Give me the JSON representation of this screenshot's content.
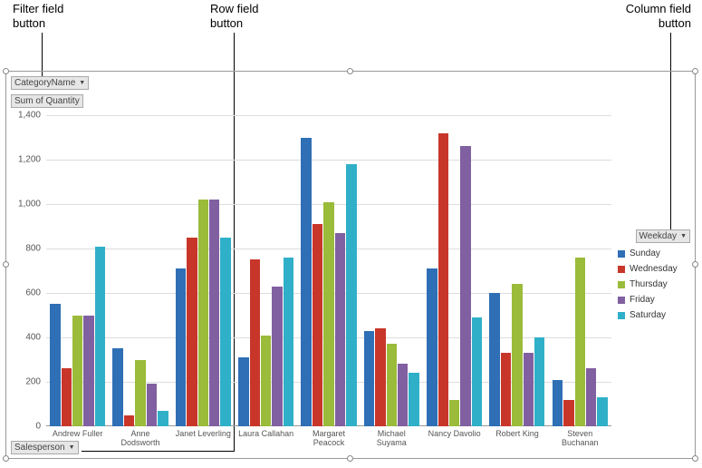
{
  "callouts": {
    "filter": {
      "line1": "Filter field",
      "line2": "button"
    },
    "row": {
      "line1": "Row field",
      "line2": "button"
    },
    "column": {
      "line1": "Column field",
      "line2": "button"
    }
  },
  "buttons": {
    "category": "CategoryName",
    "sum": "Sum of Quantity",
    "salesperson": "Salesperson",
    "weekday": "Weekday"
  },
  "legend": {
    "items": [
      {
        "label": "Sunday",
        "color": "#2F6FB5"
      },
      {
        "label": "Wednesday",
        "color": "#C8362A"
      },
      {
        "label": "Thursday",
        "color": "#9BBB3A"
      },
      {
        "label": "Friday",
        "color": "#8060A0"
      },
      {
        "label": "Saturday",
        "color": "#2FB0C8"
      }
    ]
  },
  "y_axis": {
    "ticks": [
      "0",
      "200",
      "400",
      "600",
      "800",
      "1,000",
      "1,200",
      "1,400"
    ],
    "max": 1400
  },
  "chart_data": {
    "type": "bar",
    "title": "Sum of Quantity",
    "xlabel": "Salesperson",
    "ylabel": "Sum of Quantity",
    "ylim": [
      0,
      1400
    ],
    "categories": [
      "Andrew Fuller",
      "Anne Dodsworth",
      "Janet Leverling",
      "Laura Callahan",
      "Margaret Peacock",
      "Michael Suyama",
      "Nancy Davolio",
      "Robert King",
      "Steven Buchanan"
    ],
    "category_labels": [
      "Andrew Fuller",
      "Anne\nDodsworth",
      "Janet Leverling",
      "Laura Callahan",
      "Margaret\nPeacock",
      "Michael\nSuyama",
      "Nancy Davolio",
      "Robert King",
      "Steven\nBuchanan"
    ],
    "series": [
      {
        "name": "Sunday",
        "color": "#2F6FB5",
        "values": [
          550,
          350,
          710,
          310,
          1300,
          430,
          710,
          600,
          210
        ]
      },
      {
        "name": "Wednesday",
        "color": "#C8362A",
        "values": [
          260,
          50,
          850,
          750,
          910,
          440,
          1320,
          330,
          120
        ]
      },
      {
        "name": "Thursday",
        "color": "#9BBB3A",
        "values": [
          500,
          300,
          1020,
          410,
          1010,
          370,
          120,
          640,
          760
        ]
      },
      {
        "name": "Friday",
        "color": "#8060A0",
        "values": [
          500,
          190,
          1020,
          630,
          870,
          280,
          1260,
          330,
          260
        ]
      },
      {
        "name": "Saturday",
        "color": "#2FB0C8",
        "values": [
          810,
          70,
          850,
          760,
          1180,
          240,
          490,
          400,
          130
        ]
      }
    ]
  }
}
